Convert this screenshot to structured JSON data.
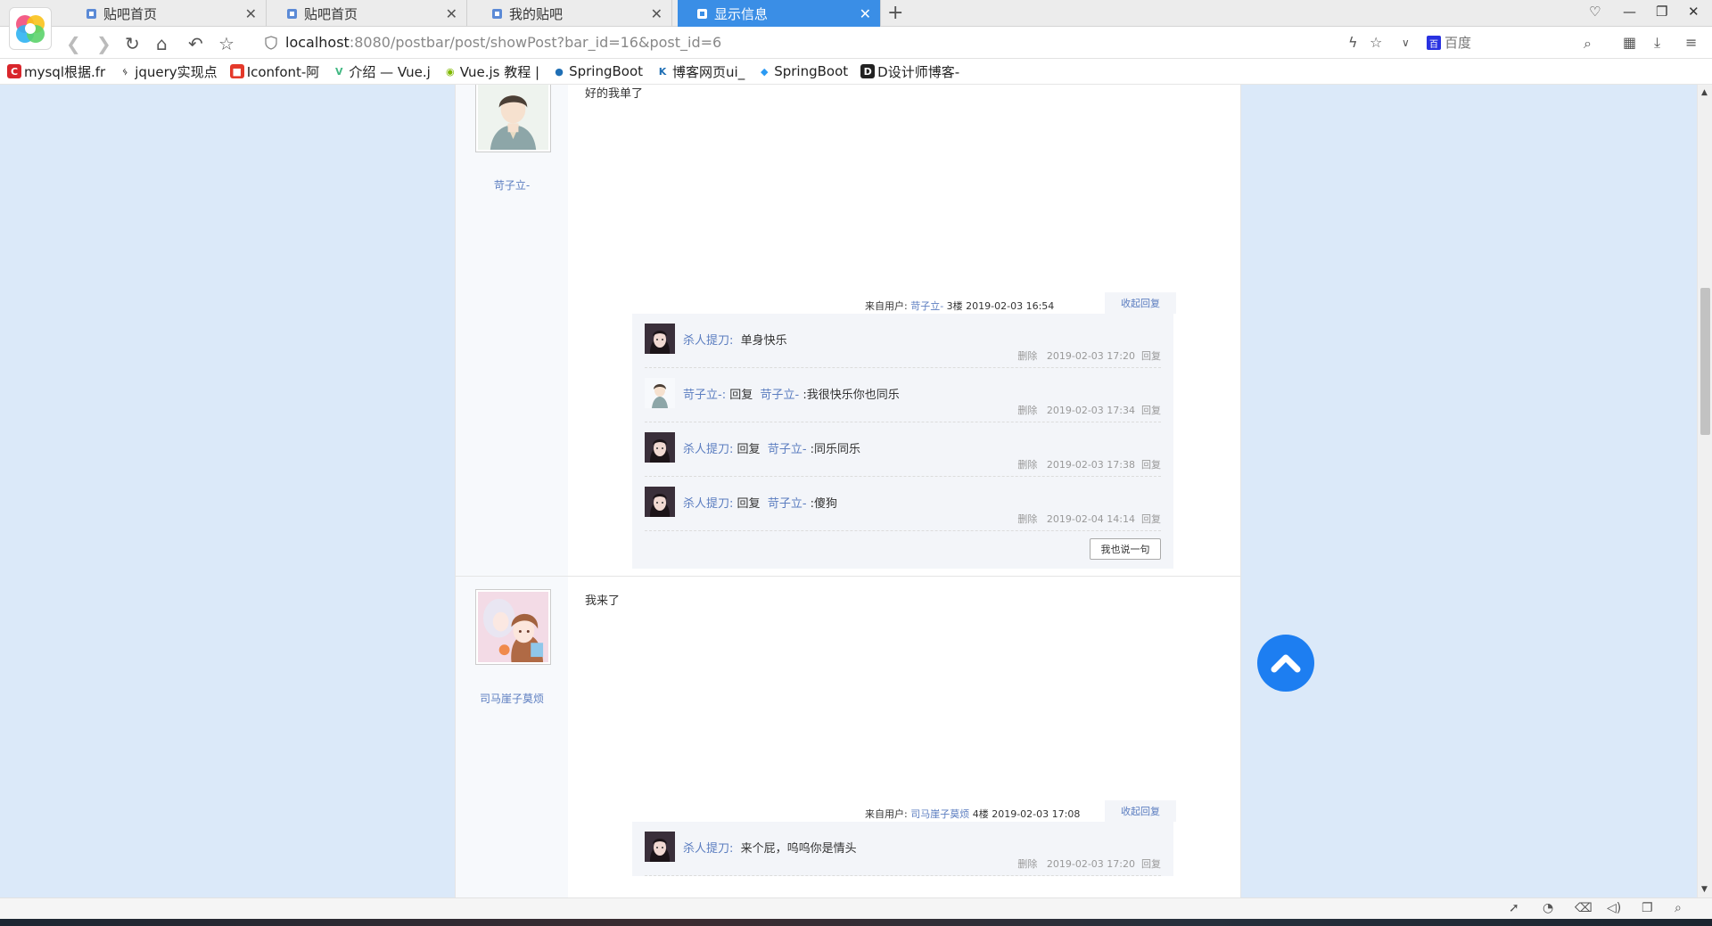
{
  "browser": {
    "tabs": [
      {
        "label": "贴吧首页"
      },
      {
        "label": "贴吧首页"
      },
      {
        "label": "我的贴吧"
      },
      {
        "label": "显示信息"
      }
    ],
    "url_host": "localhost",
    "url_rest": ":8080/postbar/post/showPost?bar_id=16&post_id=6",
    "search_placeholder": "百度",
    "accent_color": "#3a8ee6",
    "bookmarks": [
      {
        "label": "mysql根据.fr",
        "icon": "C",
        "color": "#d9262c"
      },
      {
        "label": "jquery实现点",
        "icon": "ᛃ",
        "color": "#444444"
      },
      {
        "label": "Iconfont-阿",
        "icon": "■",
        "color": "#e4392a"
      },
      {
        "label": "介绍 — Vue.j",
        "icon": "V",
        "color": "#42b883"
      },
      {
        "label": "Vue.js 教程 |",
        "icon": "◉",
        "color": "#7fb800"
      },
      {
        "label": "SpringBoot",
        "icon": "●",
        "color": "#1f6fb5"
      },
      {
        "label": "博客网页ui_",
        "icon": "K",
        "color": "#1f6fb5"
      },
      {
        "label": "SpringBoot",
        "icon": "◆",
        "color": "#2b9af3"
      },
      {
        "label": "D设计师博客-",
        "icon": "D",
        "color": "#222222"
      }
    ]
  },
  "posts": [
    {
      "user": "苛子立-",
      "text": "好的我单了",
      "meta_prefix": "来自用户: ",
      "meta_user": "苛子立-",
      "meta_suffix": " 3楼 2019-02-03 16:54",
      "fold_label": "收起回复",
      "replies": [
        {
          "user": "杀人提刀:",
          "reply_word": "",
          "target": "",
          "text": "单身快乐",
          "time": "2019-02-03 17:20",
          "avatar": "girl"
        },
        {
          "user": "苛子立-:",
          "reply_word": "回复",
          "target": "苛子立-",
          "text": ":我很快乐你也同乐",
          "time": "2019-02-03 17:34",
          "avatar": "boy"
        },
        {
          "user": "杀人提刀:",
          "reply_word": "回复",
          "target": "苛子立-",
          "text": ":同乐同乐",
          "time": "2019-02-03 17:38",
          "avatar": "girl"
        },
        {
          "user": "杀人提刀:",
          "reply_word": "回复",
          "target": "苛子立-",
          "text": ":傻狗",
          "time": "2019-02-04 14:14",
          "avatar": "girl"
        }
      ],
      "delete_label": "删除",
      "reply_label": "回复",
      "say_label": "我也说一句"
    },
    {
      "user": "司马崖子莫烦",
      "text": "我来了",
      "meta_prefix": "来自用户: ",
      "meta_user": "司马崖子莫烦",
      "meta_suffix": " 4楼 2019-02-03 17:08",
      "fold_label": "收起回复",
      "replies": [
        {
          "user": "杀人提刀:",
          "reply_word": "",
          "target": "",
          "text": "来个屁，呜呜你是情头",
          "time": "2019-02-03 17:20",
          "avatar": "girl"
        }
      ],
      "delete_label": "删除",
      "reply_label": "回复"
    }
  ]
}
